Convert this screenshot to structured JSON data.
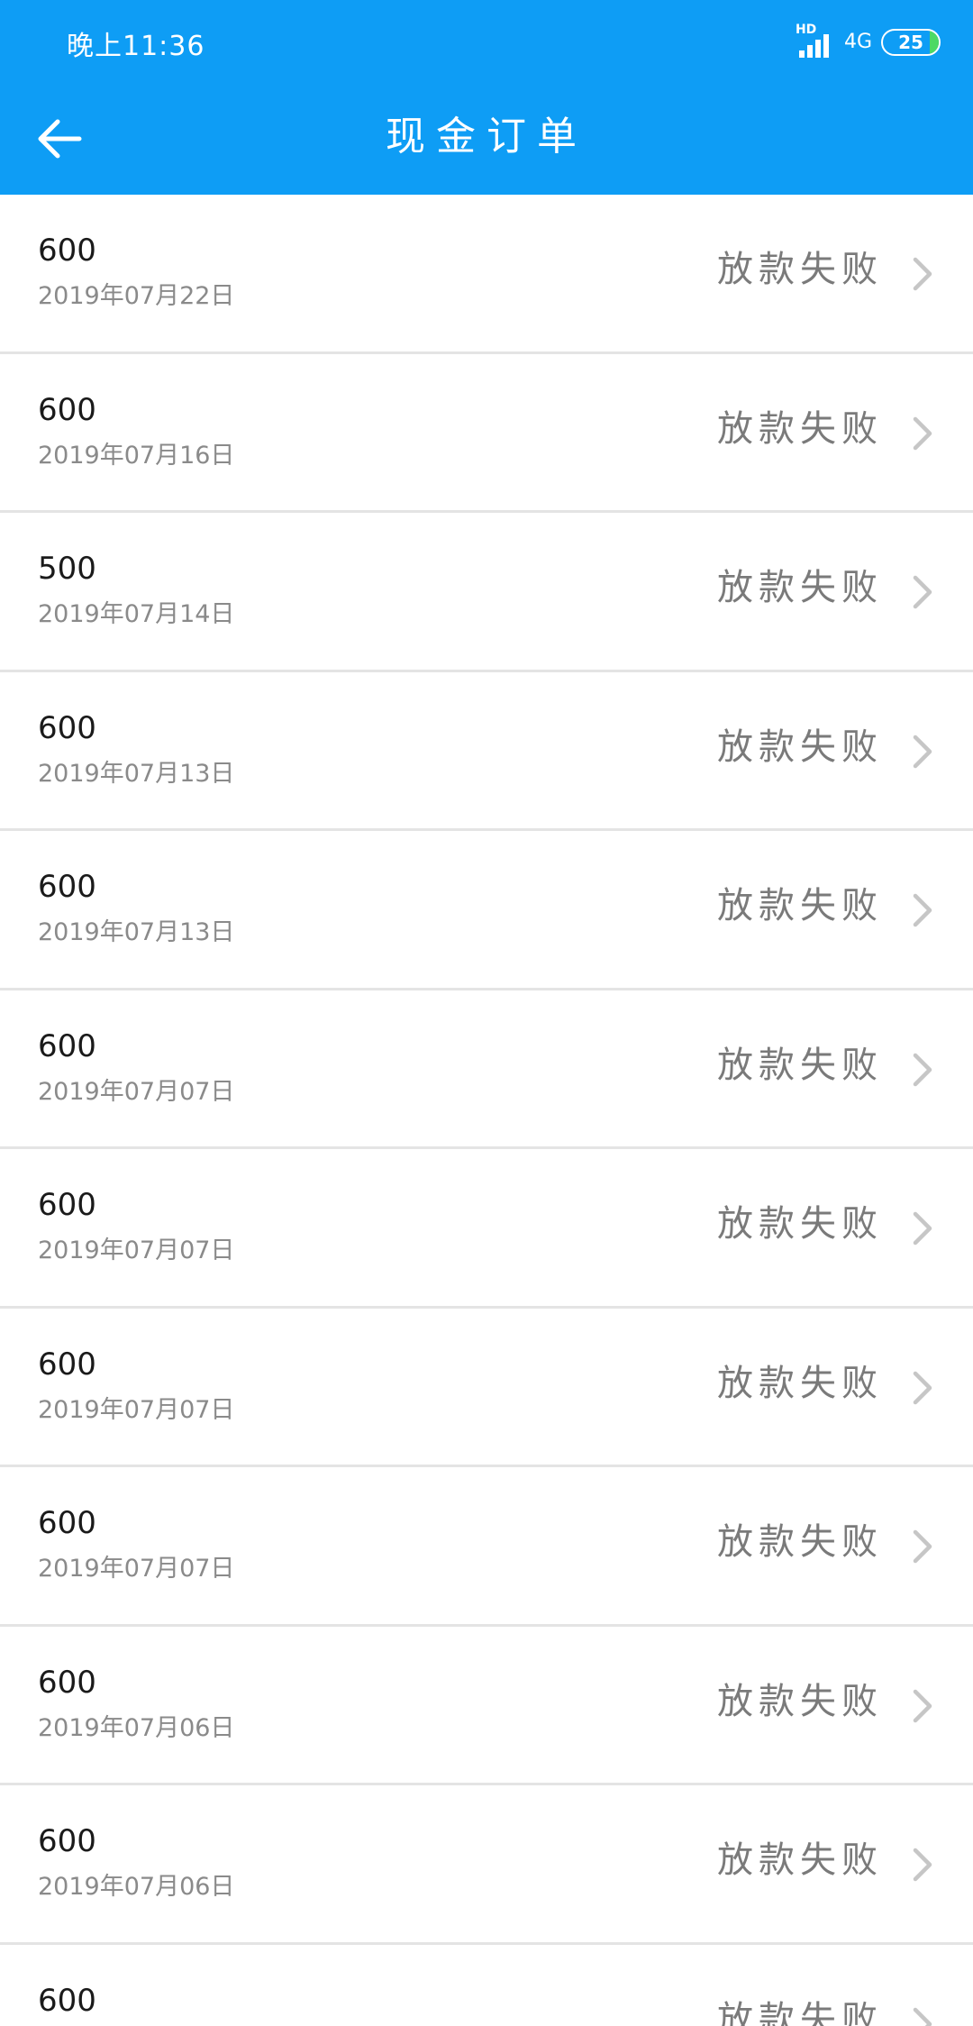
{
  "status_bar": {
    "time": "晚上11:36",
    "hd_label": "HD",
    "network": "4G",
    "battery": "25"
  },
  "nav": {
    "title": "现金订单"
  },
  "icons": {
    "back": "arrow-left-icon",
    "chevron": "chevron-right-icon"
  },
  "colors": {
    "header": "#0e9df5",
    "battery_fill": "#4cd964"
  },
  "orders": [
    {
      "amount": "600",
      "date": "2019年07月22日",
      "status": "放款失败"
    },
    {
      "amount": "600",
      "date": "2019年07月16日",
      "status": "放款失败"
    },
    {
      "amount": "500",
      "date": "2019年07月14日",
      "status": "放款失败"
    },
    {
      "amount": "600",
      "date": "2019年07月13日",
      "status": "放款失败"
    },
    {
      "amount": "600",
      "date": "2019年07月13日",
      "status": "放款失败"
    },
    {
      "amount": "600",
      "date": "2019年07月07日",
      "status": "放款失败"
    },
    {
      "amount": "600",
      "date": "2019年07月07日",
      "status": "放款失败"
    },
    {
      "amount": "600",
      "date": "2019年07月07日",
      "status": "放款失败"
    },
    {
      "amount": "600",
      "date": "2019年07月07日",
      "status": "放款失败"
    },
    {
      "amount": "600",
      "date": "2019年07月06日",
      "status": "放款失败"
    },
    {
      "amount": "600",
      "date": "2019年07月06日",
      "status": "放款失败"
    },
    {
      "amount": "600",
      "date": "",
      "status": "放款失败"
    }
  ]
}
